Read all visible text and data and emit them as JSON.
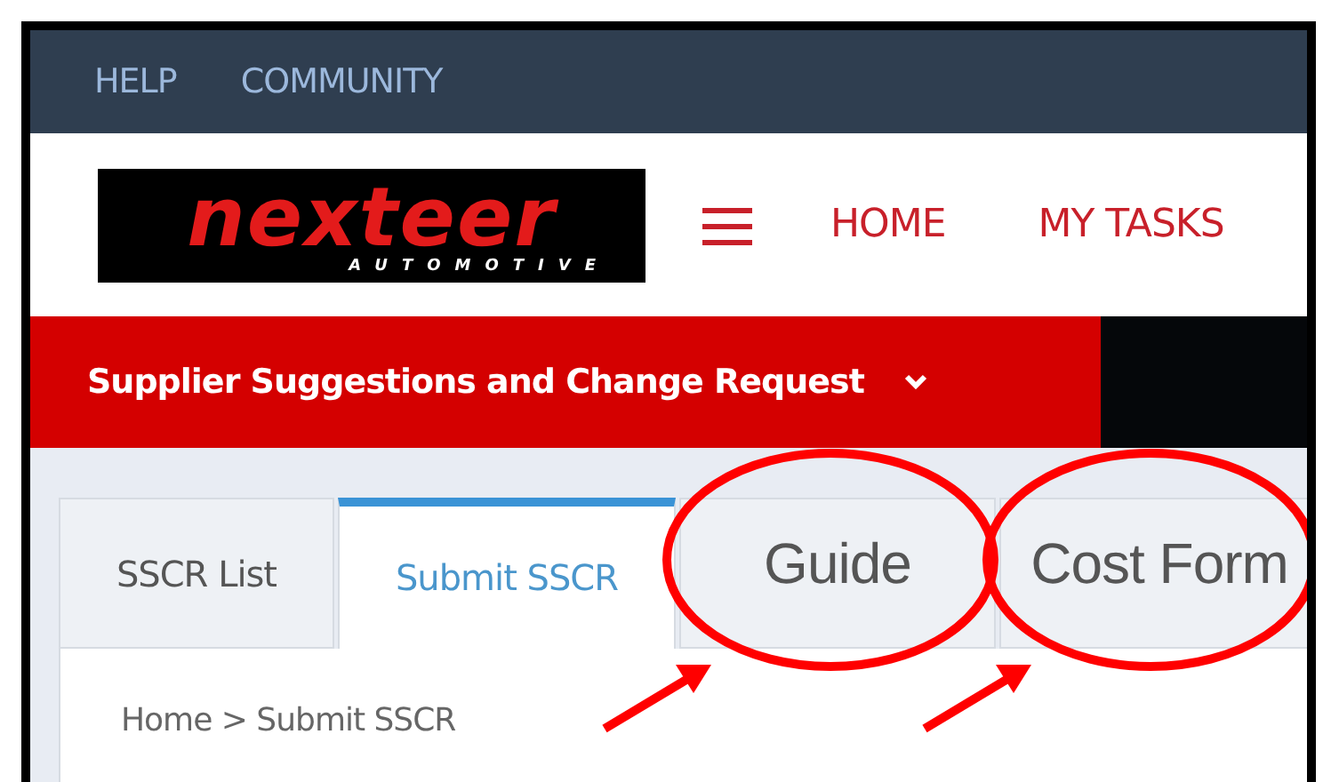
{
  "top_bar": {
    "links": [
      "HELP",
      "COMMUNITY"
    ]
  },
  "header": {
    "logo": {
      "name": "nexteer",
      "tagline": "AUTOMOTIVE"
    },
    "nav": [
      "HOME",
      "MY TASKS"
    ]
  },
  "app_bar": {
    "title": "Supplier Suggestions and Change Request"
  },
  "tabs": [
    {
      "label": "SSCR List",
      "selected": false,
      "kind": "standard",
      "circled": false
    },
    {
      "label": "Submit SSCR",
      "selected": true,
      "kind": "standard",
      "circled": false
    },
    {
      "label": "Guide",
      "selected": false,
      "kind": "pasted",
      "circled": true
    },
    {
      "label": "Cost Form",
      "selected": false,
      "kind": "pasted",
      "circled": true
    }
  ],
  "breadcrumb": "Home > Submit SSCR"
}
